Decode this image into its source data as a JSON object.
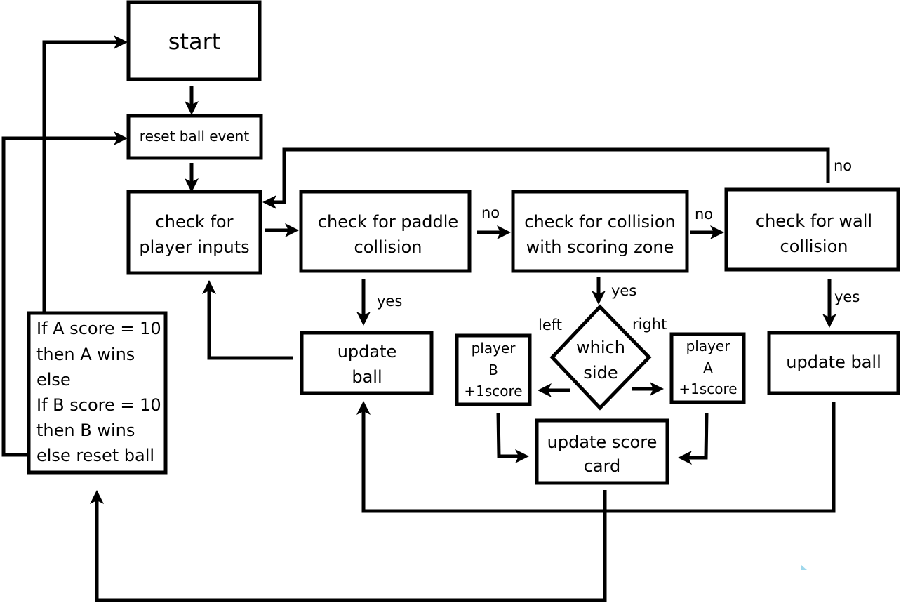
{
  "nodes": {
    "start": {
      "lines": [
        "start"
      ]
    },
    "reset_ball_event": {
      "lines": [
        "reset ball event"
      ]
    },
    "check_player_inputs": {
      "lines": [
        "check for",
        "player inputs"
      ]
    },
    "check_paddle_collision": {
      "lines": [
        "check for paddle",
        "collision"
      ]
    },
    "check_scoring_zone": {
      "lines": [
        "check for collision",
        "with scoring zone"
      ]
    },
    "check_wall_collision": {
      "lines": [
        "check for wall",
        "collision"
      ]
    },
    "update_ball_paddle": {
      "lines": [
        "update",
        "ball"
      ]
    },
    "update_ball_wall": {
      "lines": [
        "update ball"
      ]
    },
    "which_side": {
      "lines": [
        "which",
        "side"
      ]
    },
    "player_b_score": {
      "lines": [
        "player",
        "B",
        "+1score"
      ]
    },
    "player_a_score": {
      "lines": [
        "player",
        "A",
        "+1score"
      ]
    },
    "update_score_card": {
      "lines": [
        "update score",
        "card"
      ]
    },
    "win_check": {
      "lines": [
        "If A score = 10",
        "then A wins",
        "else",
        "If B score  = 10",
        "then B wins",
        "else reset ball"
      ]
    }
  },
  "edge_labels": {
    "paddle_no": "no",
    "scoring_no": "no",
    "wall_no": "no",
    "paddle_yes": "yes",
    "scoring_yes": "yes",
    "wall_yes": "yes",
    "left": "left",
    "right": "right"
  },
  "colors": {
    "stroke": "#000000",
    "background": "#ffffff",
    "mark": "#9fd8ec"
  }
}
